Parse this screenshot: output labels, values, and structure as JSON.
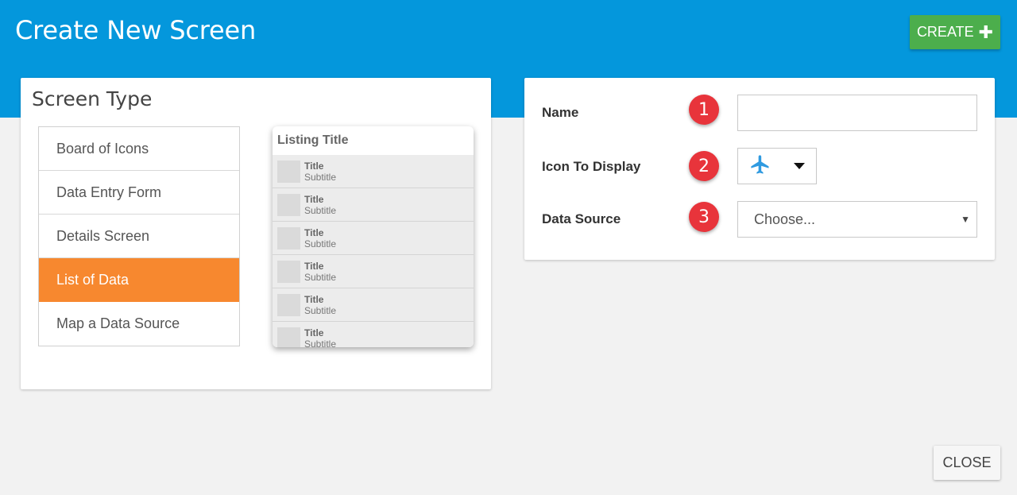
{
  "header": {
    "title": "Create New Screen",
    "create_label": "CREATE",
    "create_icon": "plus-icon"
  },
  "screen_type": {
    "title": "Screen Type",
    "items": [
      {
        "label": "Board of Icons",
        "selected": false
      },
      {
        "label": "Data Entry Form",
        "selected": false
      },
      {
        "label": "Details Screen",
        "selected": false
      },
      {
        "label": "List of Data",
        "selected": true
      },
      {
        "label": "Map a Data Source",
        "selected": false
      }
    ],
    "selected_color": "#f7882f"
  },
  "preview": {
    "title": "Listing Title",
    "rows": [
      {
        "title": "Title",
        "subtitle": "Subtitle"
      },
      {
        "title": "Title",
        "subtitle": "Subtitle"
      },
      {
        "title": "Title",
        "subtitle": "Subtitle"
      },
      {
        "title": "Title",
        "subtitle": "Subtitle"
      },
      {
        "title": "Title",
        "subtitle": "Subtitle"
      },
      {
        "title": "Title",
        "subtitle": "Subtitle"
      }
    ]
  },
  "form": {
    "name_label": "Name",
    "name_value": "",
    "name_badge": "1",
    "icon_label": "Icon To Display",
    "icon_badge": "2",
    "icon_selected": "airplane-icon",
    "icon_color": "#2f9ae0",
    "source_label": "Data Source",
    "source_badge": "3",
    "source_value": "Choose..."
  },
  "footer": {
    "close_label": "CLOSE"
  },
  "colors": {
    "header_bg": "#0497dc",
    "create_bg": "#4cae4c",
    "badge_bg": "#e8343b"
  }
}
